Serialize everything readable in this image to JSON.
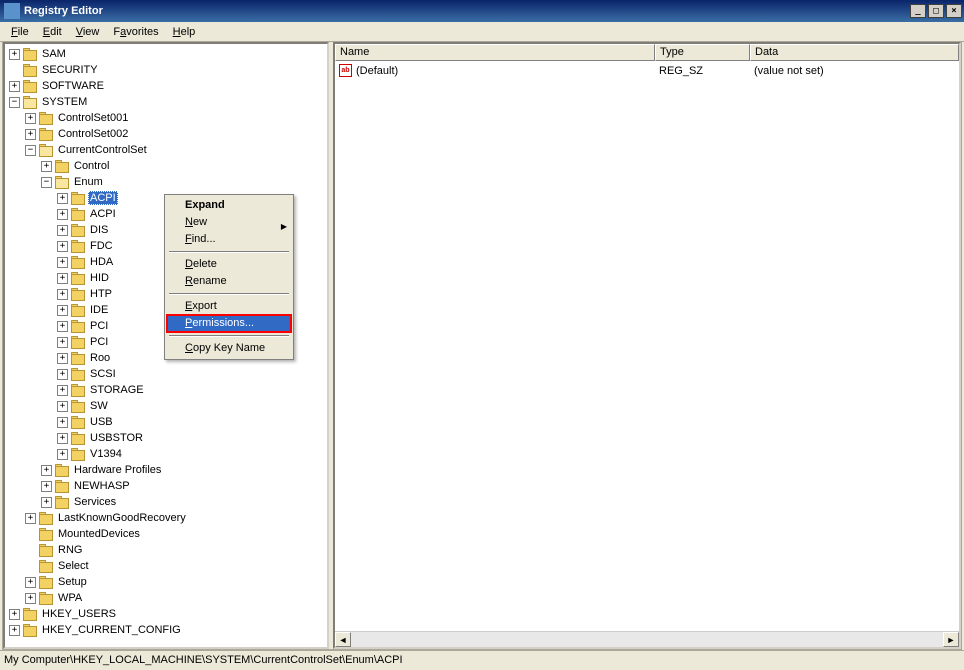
{
  "title": "Registry Editor",
  "menubar": [
    "File",
    "Edit",
    "View",
    "Favorites",
    "Help"
  ],
  "tree": {
    "sam": "SAM",
    "security": "SECURITY",
    "software": "SOFTWARE",
    "system": "SYSTEM",
    "cs001": "ControlSet001",
    "cs002": "ControlSet002",
    "ccs": "CurrentControlSet",
    "control": "Control",
    "enum": "Enum",
    "acpi": "ACPI",
    "acpi2": "ACPI",
    "dis": "DIS",
    "fdc": "FDC",
    "hda": "HDA",
    "hid": "HID",
    "htp": "HTP",
    "ide": "IDE",
    "pci": "PCI",
    "pci2": "PCI",
    "roo": "Roo",
    "scsi": "SCSI",
    "storage": "STORAGE",
    "sw": "SW",
    "usb": "USB",
    "usbstor": "USBSTOR",
    "v1394": "V1394",
    "hwprofiles": "Hardware Profiles",
    "newhasp": "NEWHASP",
    "services": "Services",
    "lastknown": "LastKnownGoodRecovery",
    "mounted": "MountedDevices",
    "rng": "RNG",
    "select": "Select",
    "setup": "Setup",
    "wpa": "WPA",
    "hku": "HKEY_USERS",
    "hkcc": "HKEY_CURRENT_CONFIG"
  },
  "columns": {
    "name": "Name",
    "type": "Type",
    "data": "Data"
  },
  "values": [
    {
      "name": "(Default)",
      "type": "REG_SZ",
      "data": "(value not set)"
    }
  ],
  "context_menu": {
    "expand": "Expand",
    "new": "New",
    "find": "Find...",
    "delete": "Delete",
    "rename": "Rename",
    "export": "Export",
    "permissions": "Permissions...",
    "copy": "Copy Key Name"
  },
  "statusbar": "My Computer\\HKEY_LOCAL_MACHINE\\SYSTEM\\CurrentControlSet\\Enum\\ACPI"
}
